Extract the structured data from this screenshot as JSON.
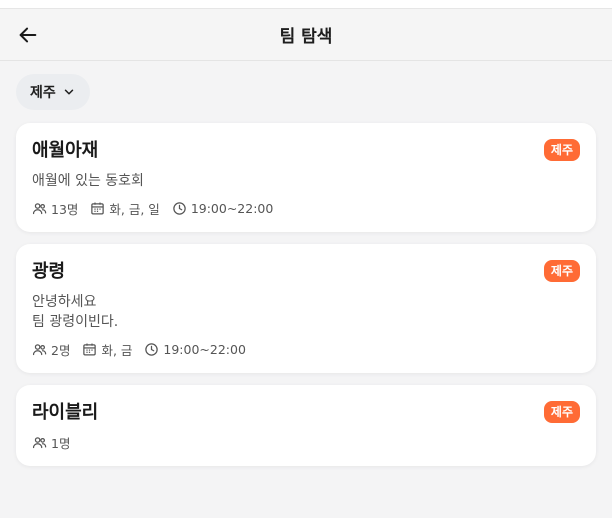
{
  "header": {
    "title": "팀 탐색"
  },
  "filter": {
    "region_label": "제주"
  },
  "teams": [
    {
      "name": "애월아재",
      "region": "제주",
      "description": "애월에 있는 동호회",
      "members": "13명",
      "days": "화, 금, 일",
      "time": "19:00~22:00"
    },
    {
      "name": "광령",
      "region": "제주",
      "description": "안녕하세요\n팀 광령이빈다.",
      "members": "2명",
      "days": "화, 금",
      "time": "19:00~22:00"
    },
    {
      "name": "라이블리",
      "region": "제주",
      "members": "1명"
    }
  ],
  "colors": {
    "accent": "#ff6b35",
    "background": "#f4f4f5",
    "card": "#ffffff"
  },
  "icons": [
    "arrow-left-icon",
    "chevron-down-icon",
    "users-icon",
    "calendar-icon",
    "clock-icon"
  ]
}
